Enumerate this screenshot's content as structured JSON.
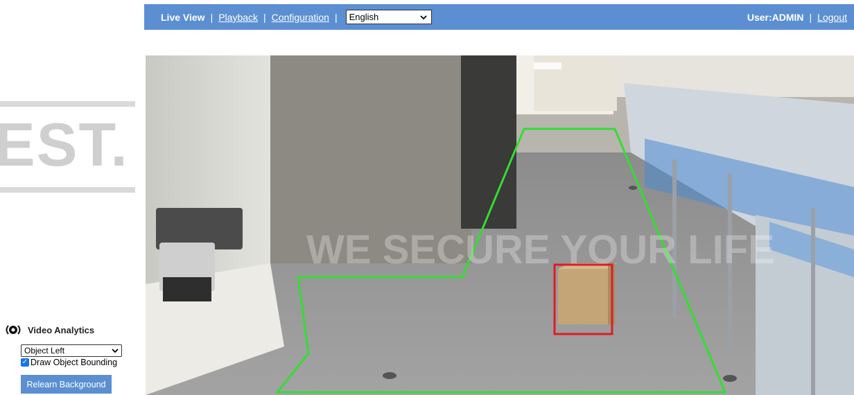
{
  "header": {
    "live_view": "Live View",
    "playback": "Playback",
    "configuration": "Configuration",
    "separator": "|",
    "language": "English",
    "user_label": "User:ADMIN",
    "logout": "Logout"
  },
  "watermark": {
    "left_text": "EST."
  },
  "panel": {
    "title": "Video Analytics",
    "mode_selected": "Object Left",
    "draw_bounding_label": "Draw Object Bounding",
    "draw_bounding_checked": true,
    "relearn_label": "Relearn Background"
  },
  "video": {
    "watermark_text": "WE SECURE YOUR LIFE",
    "zone_color": "#33dd33",
    "object_box_color": "#e01b24"
  },
  "colors": {
    "accent": "#5b8fd2"
  }
}
